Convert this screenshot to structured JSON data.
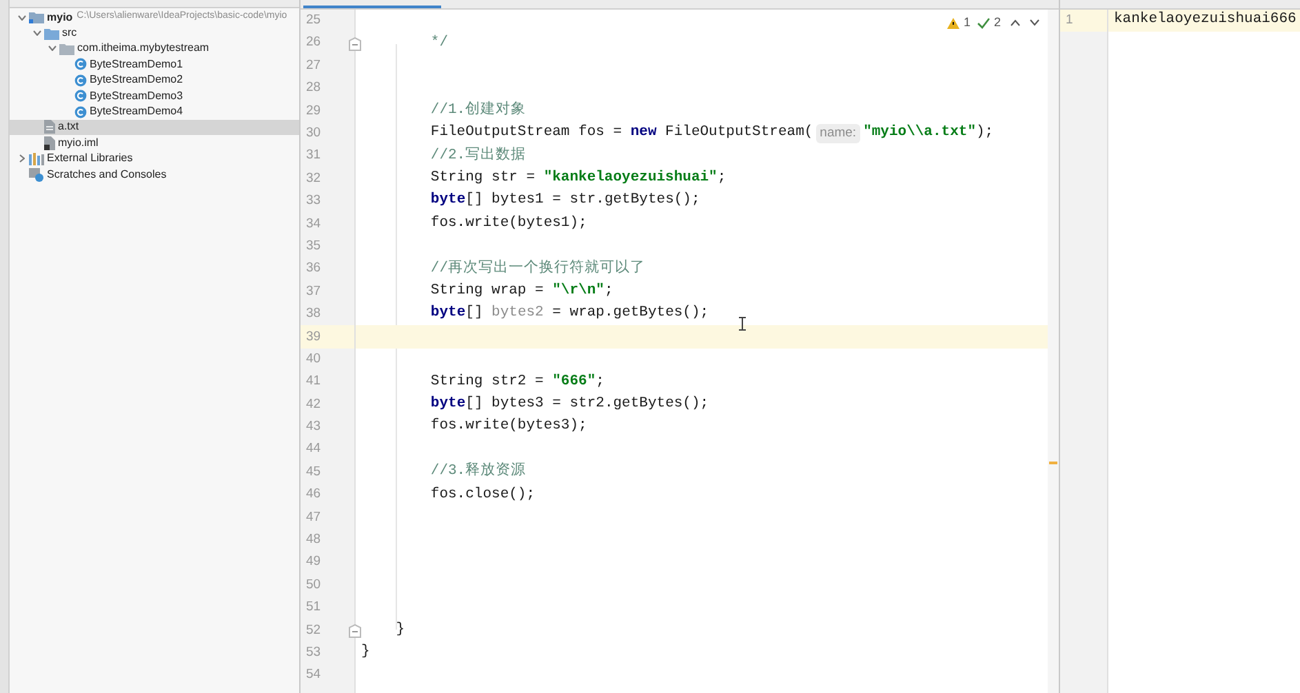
{
  "project_tree": [
    {
      "label": "myio",
      "path": "C:\\Users\\alienware\\IdeaProjects\\basic-code\\myio",
      "kind": "module",
      "expanded": true,
      "selected": false,
      "children": [
        {
          "label": "src",
          "kind": "folder",
          "expanded": true,
          "selected": false,
          "children": [
            {
              "label": "com.itheima.mybytestream",
              "kind": "package",
              "expanded": true,
              "selected": false,
              "children": [
                {
                  "label": "ByteStreamDemo1",
                  "kind": "java-class",
                  "selected": false
                },
                {
                  "label": "ByteStreamDemo2",
                  "kind": "java-class",
                  "selected": false
                },
                {
                  "label": "ByteStreamDemo3",
                  "kind": "java-class",
                  "selected": false
                },
                {
                  "label": "ByteStreamDemo4",
                  "kind": "java-class",
                  "selected": false
                }
              ]
            }
          ]
        },
        {
          "label": "a.txt",
          "kind": "text-file",
          "selected": true
        },
        {
          "label": "myio.iml",
          "kind": "iml-file",
          "selected": false
        }
      ]
    },
    {
      "label": "External Libraries",
      "kind": "library",
      "expanded": false,
      "selected": false
    },
    {
      "label": "Scratches and Consoles",
      "kind": "scratches",
      "selected": false
    }
  ],
  "editor": {
    "warnings": "1",
    "weak_warnings": "2",
    "lines": [
      {
        "number": "25",
        "fold": false,
        "current": false
      },
      {
        "number": "26",
        "fold": true,
        "current": false,
        "tokens": [
          {
            "kind": "comment",
            "text": "        */"
          }
        ]
      },
      {
        "number": "27",
        "fold": false,
        "current": false
      },
      {
        "number": "28",
        "fold": false,
        "current": false
      },
      {
        "number": "29",
        "fold": false,
        "current": false,
        "tokens": [
          {
            "kind": "comment",
            "text": "        //1.创建对象"
          }
        ]
      },
      {
        "number": "30",
        "fold": false,
        "current": false,
        "tokens": [
          {
            "kind": "code",
            "text": "        FileOutputStream fos = **new** FileOutputStream("
          },
          {
            "kind": "hint",
            "text": "name:"
          },
          {
            "kind": "string",
            "text": "\"myio\\\\a.txt\""
          },
          {
            "kind": "code",
            "text": ");"
          }
        ]
      },
      {
        "number": "31",
        "fold": false,
        "current": false,
        "tokens": [
          {
            "kind": "comment",
            "text": "        //2.写出数据"
          }
        ]
      },
      {
        "number": "32",
        "fold": false,
        "current": false,
        "tokens": [
          {
            "kind": "code",
            "text": "        String str = "
          },
          {
            "kind": "string",
            "text": "\"kankelaoyezuishuai\""
          },
          {
            "kind": "code",
            "text": ";"
          }
        ]
      },
      {
        "number": "33",
        "fold": false,
        "current": false,
        "tokens": [
          {
            "kind": "code",
            "text": "        **byte**[] bytes1 = str.getBytes();"
          }
        ]
      },
      {
        "number": "34",
        "fold": false,
        "current": false,
        "tokens": [
          {
            "kind": "code",
            "text": "        fos.write(bytes1);"
          }
        ]
      },
      {
        "number": "35",
        "fold": false,
        "current": false
      },
      {
        "number": "36",
        "fold": false,
        "current": false,
        "tokens": [
          {
            "kind": "comment",
            "text": "        //再次写出一个换行符就可以了"
          }
        ]
      },
      {
        "number": "37",
        "fold": false,
        "current": false,
        "tokens": [
          {
            "kind": "code",
            "text": "        String wrap = "
          },
          {
            "kind": "string",
            "text": "\"\\r\\n\""
          },
          {
            "kind": "code",
            "text": ";"
          }
        ]
      },
      {
        "number": "38",
        "fold": false,
        "current": false,
        "tokens": [
          {
            "kind": "code",
            "text": "        **byte**[] "
          },
          {
            "kind": "unused",
            "text": "bytes2"
          },
          {
            "kind": "code",
            "text": " = wrap.getBytes();"
          }
        ]
      },
      {
        "number": "39",
        "fold": false,
        "current": true
      },
      {
        "number": "40",
        "fold": false,
        "current": false
      },
      {
        "number": "41",
        "fold": false,
        "current": false,
        "tokens": [
          {
            "kind": "code",
            "text": "        String str2 = "
          },
          {
            "kind": "string",
            "text": "\"666\""
          },
          {
            "kind": "code",
            "text": ";"
          }
        ]
      },
      {
        "number": "42",
        "fold": false,
        "current": false,
        "tokens": [
          {
            "kind": "code",
            "text": "        **byte**[] bytes3 = str2.getBytes();"
          }
        ]
      },
      {
        "number": "43",
        "fold": false,
        "current": false,
        "tokens": [
          {
            "kind": "code",
            "text": "        fos.write(bytes3);"
          }
        ]
      },
      {
        "number": "44",
        "fold": false,
        "current": false
      },
      {
        "number": "45",
        "fold": false,
        "current": false,
        "tokens": [
          {
            "kind": "comment",
            "text": "        //3.释放资源"
          }
        ]
      },
      {
        "number": "46",
        "fold": false,
        "current": false,
        "tokens": [
          {
            "kind": "code",
            "text": "        fos.close();"
          }
        ]
      },
      {
        "number": "47",
        "fold": false,
        "current": false
      },
      {
        "number": "48",
        "fold": false,
        "current": false
      },
      {
        "number": "49",
        "fold": false,
        "current": false
      },
      {
        "number": "50",
        "fold": false,
        "current": false
      },
      {
        "number": "51",
        "fold": false,
        "current": false
      },
      {
        "number": "52",
        "fold": true,
        "current": false,
        "tokens": [
          {
            "kind": "code",
            "text": "    }"
          }
        ]
      },
      {
        "number": "53",
        "fold": false,
        "current": false,
        "tokens": [
          {
            "kind": "code",
            "text": "}"
          }
        ]
      },
      {
        "number": "54",
        "fold": false,
        "current": false
      }
    ]
  },
  "text_editor": {
    "lines": [
      {
        "number": "1",
        "text": "kankelaoyezuishuai666"
      }
    ]
  }
}
